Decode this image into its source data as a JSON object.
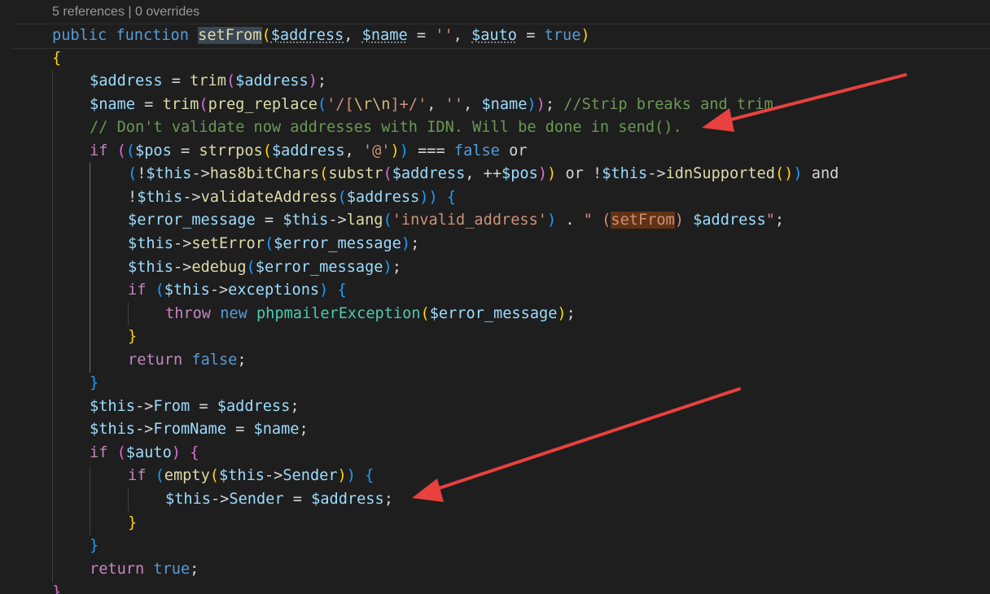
{
  "codelens": {
    "references": "5 references",
    "separator": "|",
    "overrides": "0 overrides"
  },
  "lines": [
    "public function setFrom($address, $name = '', $auto = true)",
    "{",
    "$address = trim($address);",
    "$name = trim(preg_replace('/[\\r\\n]+/', '', $name)); //Strip breaks and trim",
    "// Don't validate now addresses with IDN. Will be done in send().",
    "if (($pos = strrpos($address, '@')) === false or",
    "(!$this->has8bitChars(substr($address, ++$pos)) or !$this->idnSupported()) and",
    "!$this->validateAddress($address)) {",
    "$error_message = $this->lang('invalid_address') . \" (setFrom) $address\";",
    "$this->setError($error_message);",
    "$this->edebug($error_message);",
    "if ($this->exceptions) {",
    "throw new phpmailerException($error_message);",
    "}",
    "return false;",
    "}",
    "$this->From = $address;",
    "$this->FromName = $name;",
    "if ($auto) {",
    "if (empty($this->Sender)) {",
    "$this->Sender = $address;",
    "}",
    "}",
    "return true;",
    "}"
  ],
  "annotations": {
    "arrow_color": "#e8413f",
    "arrows": [
      "arrow-to-idn-comment",
      "arrow-to-sender-assignment"
    ]
  },
  "theme": {
    "background": "#1e1e1e",
    "keyword": "#569cd6",
    "control": "#c586c0",
    "function": "#dcdcaa",
    "variable": "#9cdcfe",
    "string": "#ce9178",
    "comment": "#6a9955",
    "class": "#4ec9b0"
  }
}
